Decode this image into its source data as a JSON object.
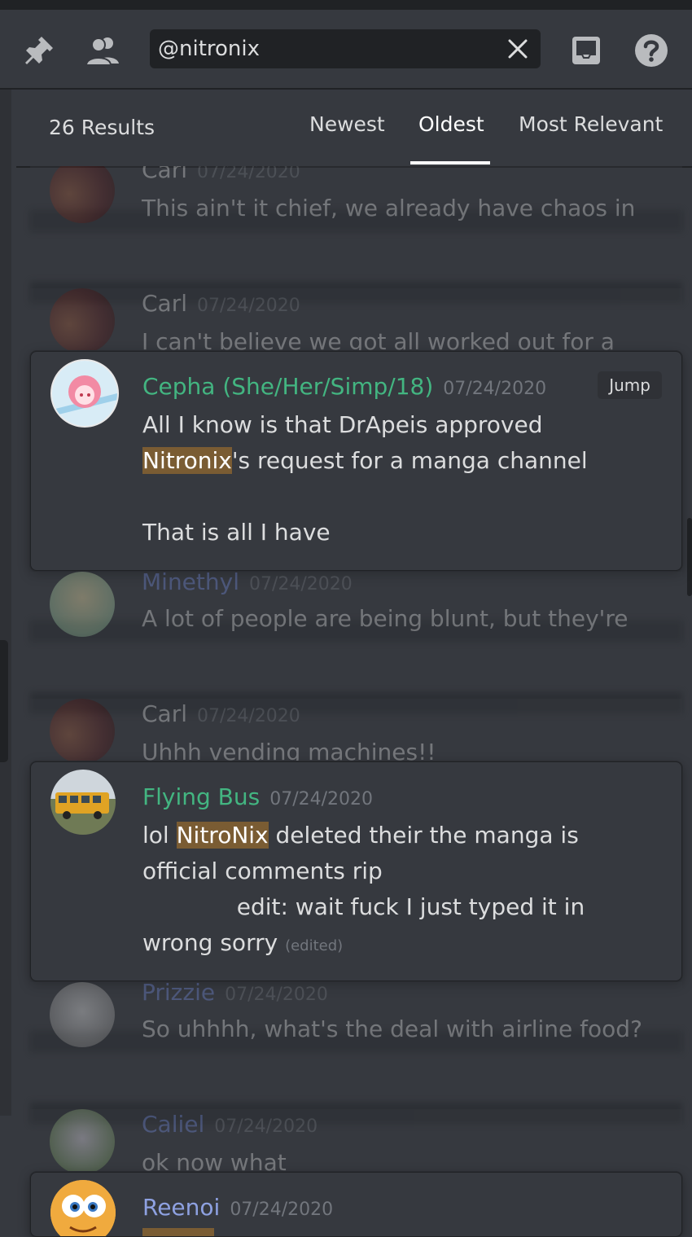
{
  "toolbar": {
    "pin_icon": "pin-icon",
    "members_icon": "members-icon",
    "search_value": "@nitronix",
    "clear_icon": "close-icon",
    "inbox_icon": "inbox-icon",
    "help_icon": "help-icon"
  },
  "results": {
    "count_label": "26 Results",
    "sort_tabs": [
      "Newest",
      "Oldest",
      "Most Relevant"
    ],
    "active_sort": "Oldest"
  },
  "messages": [
    {
      "author": "Carl",
      "timestamp": "07/24/2020",
      "text": "This ain't it chief, we already have chaos in here",
      "author_color": "#dcddde"
    },
    {
      "author": "Carl",
      "timestamp": "07/24/2020",
      "text": "I can't believe we got all worked out for a",
      "author_color": "#dcddde"
    },
    {
      "author": "Cepha (She/Her/Simp/18)",
      "timestamp": "07/24/2020",
      "author_color": "#43b581",
      "text_before": "All I know is that DrApeis approved ",
      "highlight": "Nitronix",
      "text_after": "'s request for a manga channel",
      "text_line2": "That is all I have",
      "jump_label": "Jump"
    },
    {
      "author": "Minethyl",
      "timestamp": "07/24/2020",
      "text": "A lot of people are being blunt, but they're not",
      "author_color": "#7289da"
    },
    {
      "author": "Carl",
      "timestamp": "07/24/2020",
      "text": "Uhhh vending machines!!",
      "author_color": "#dcddde"
    },
    {
      "author": "Flying Bus",
      "timestamp": "07/24/2020",
      "author_color": "#43b581",
      "text_before": "lol ",
      "highlight": "NitroNix",
      "text_after": " deleted their the manga is official comments rip",
      "text_line2": "             edit: wait fuck I just typed it in wrong sorry",
      "edited_label": "(edited)"
    },
    {
      "author": "Prizzie",
      "timestamp": "07/24/2020",
      "text": "So uhhhh, what's the deal with airline food?",
      "author_color": "#7289da"
    },
    {
      "author": "Caliel",
      "timestamp": "07/24/2020",
      "text": "ok now what",
      "author_color": "#7289da"
    },
    {
      "author": "Reenoi",
      "timestamp": "07/24/2020",
      "author_color": "#8ea1e1"
    }
  ]
}
